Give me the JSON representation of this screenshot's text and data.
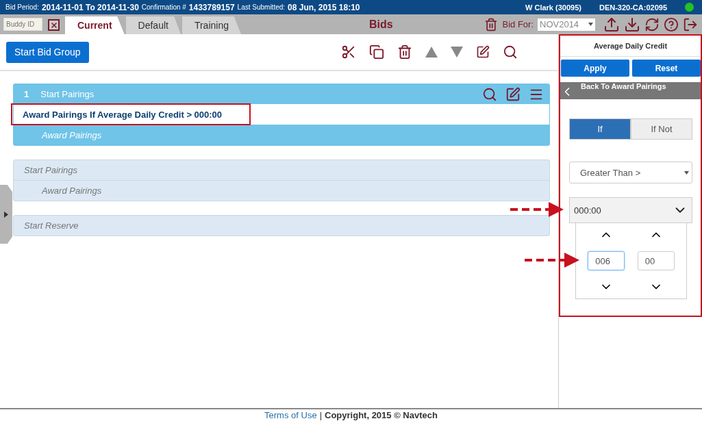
{
  "header": {
    "bid_period_label": "Bid Period:",
    "bid_period": "2014-11-01 To 2014-11-30",
    "confirmation_label": "Confirmation #",
    "confirmation": "1433789157",
    "last_submitted_label": "Last Submitted:",
    "last_submitted": "08 Jun, 2015 18:10",
    "user": "W Clark (30095)",
    "code": "DEN-320-CA:02095",
    "online": true
  },
  "tab_bar": {
    "buddy_placeholder": "Buddy ID",
    "tabs": [
      {
        "label": "Current",
        "selected": true
      },
      {
        "label": "Default",
        "selected": false
      },
      {
        "label": "Training",
        "selected": false
      }
    ],
    "title": "Bids",
    "bid_for_label": "Bid For:",
    "bid_for": "NOV2014"
  },
  "toolbar": {
    "start_button": "Start Bid Group"
  },
  "groups": [
    {
      "number": "1",
      "active": true,
      "header": "Start Pairings",
      "rule": "Award Pairings If Average Daily Credit > 000:00",
      "children": [
        "Award Pairings"
      ]
    },
    {
      "active": false,
      "header": "Start Pairings",
      "children": [
        "Award Pairings"
      ]
    },
    {
      "active": false,
      "header": "Start Reserve"
    }
  ],
  "panel": {
    "title": "Average Daily Credit",
    "buttons": [
      "Apply",
      "Reset"
    ],
    "back": "Back To Award Pairings",
    "toggle": [
      {
        "label": "If",
        "selected": true
      },
      {
        "label": "If Not",
        "selected": false
      }
    ],
    "comparison": "Greater Than >",
    "time_value": "000:00",
    "hours": "006",
    "minutes": "00"
  },
  "footer": {
    "link": "Terms of Use",
    "separator": "|",
    "copyright": "Copyright, 2015 © Navtech"
  }
}
